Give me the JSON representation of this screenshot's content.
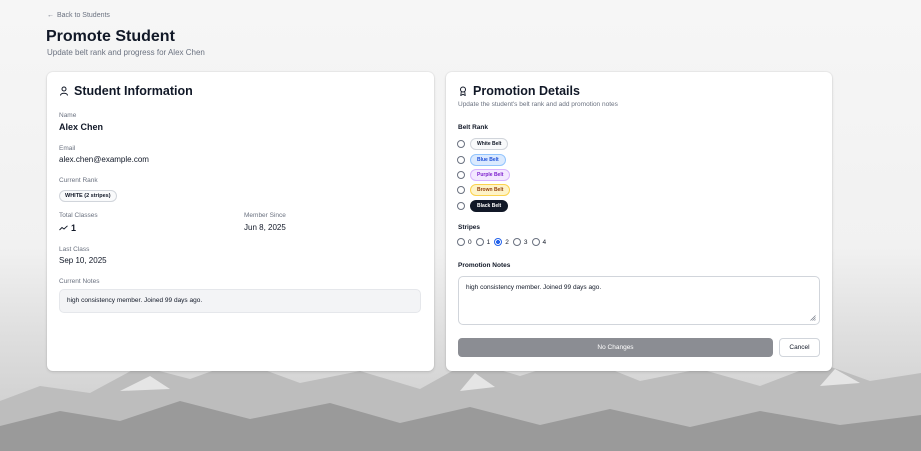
{
  "header": {
    "back_label": "Back to Students",
    "title": "Promote Student",
    "subtitle": "Update belt rank and progress for Alex Chen"
  },
  "student_info": {
    "title": "Student Information",
    "name_label": "Name",
    "name": "Alex Chen",
    "email_label": "Email",
    "email": "alex.chen@example.com",
    "rank_label": "Current Rank",
    "rank": "WHITE (2 stripes)",
    "classes_label": "Total Classes",
    "classes": "1",
    "member_since_label": "Member Since",
    "member_since": "Jun 8, 2025",
    "last_class_label": "Last Class",
    "last_class": "Sep 10, 2025",
    "notes_label": "Current Notes",
    "notes": "high consistency member. Joined 99 days ago."
  },
  "promotion": {
    "title": "Promotion Details",
    "description": "Update the student's belt rank and add promotion notes",
    "belt_rank_label": "Belt Rank",
    "belts": [
      {
        "label": "White Belt",
        "selected": false
      },
      {
        "label": "Blue Belt",
        "selected": false
      },
      {
        "label": "Purple Belt",
        "selected": false
      },
      {
        "label": "Brown Belt",
        "selected": false
      },
      {
        "label": "Black Belt",
        "selected": false
      }
    ],
    "stripes_label": "Stripes",
    "stripes": [
      "0",
      "1",
      "2",
      "3",
      "4"
    ],
    "stripes_selected": "2",
    "notes_label": "Promotion Notes",
    "notes_value": "high consistency member. Joined 99 days ago.",
    "submit_label": "No Changes",
    "cancel_label": "Cancel"
  },
  "colors": {
    "accent": "#2563eb",
    "disabled_button": "#8b8d93"
  }
}
